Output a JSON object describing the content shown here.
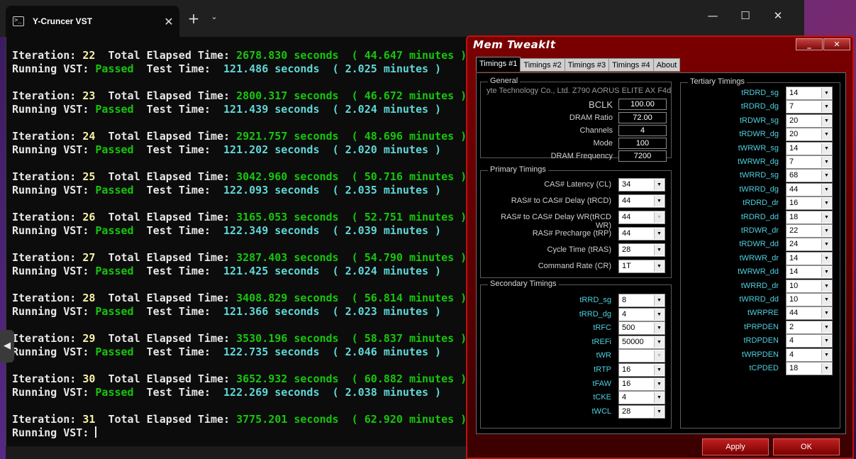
{
  "terminal": {
    "tab_title": "Y-Cruncer VST",
    "tab_icon": "terminal-icon",
    "new_tab_symbol": "+",
    "dropdown_symbol": "⌄",
    "close_symbol": "✕",
    "window_controls": {
      "minimize": "—",
      "maximize": "☐",
      "close": "✕"
    },
    "labels": {
      "iteration": "Iteration:",
      "total_elapsed": "Total Elapsed Time:",
      "seconds": "seconds",
      "minutes": "minutes",
      "running_vst": "Running VST:",
      "test_time": "Test Time:"
    },
    "iterations": [
      {
        "n": "22",
        "elapsed": "2678.830",
        "elapsed_min": "44.647",
        "status": "Passed",
        "test": "121.486",
        "test_min": "2.025"
      },
      {
        "n": "23",
        "elapsed": "2800.317",
        "elapsed_min": "46.672",
        "status": "Passed",
        "test": "121.439",
        "test_min": "2.024"
      },
      {
        "n": "24",
        "elapsed": "2921.757",
        "elapsed_min": "48.696",
        "status": "Passed",
        "test": "121.202",
        "test_min": "2.020"
      },
      {
        "n": "25",
        "elapsed": "3042.960",
        "elapsed_min": "50.716",
        "status": "Passed",
        "test": "122.093",
        "test_min": "2.035"
      },
      {
        "n": "26",
        "elapsed": "3165.053",
        "elapsed_min": "52.751",
        "status": "Passed",
        "test": "122.349",
        "test_min": "2.039"
      },
      {
        "n": "27",
        "elapsed": "3287.403",
        "elapsed_min": "54.790",
        "status": "Passed",
        "test": "121.425",
        "test_min": "2.024"
      },
      {
        "n": "28",
        "elapsed": "3408.829",
        "elapsed_min": "56.814",
        "status": "Passed",
        "test": "121.366",
        "test_min": "2.023"
      },
      {
        "n": "29",
        "elapsed": "3530.196",
        "elapsed_min": "58.837",
        "status": "Passed",
        "test": "122.735",
        "test_min": "2.046"
      },
      {
        "n": "30",
        "elapsed": "3652.932",
        "elapsed_min": "60.882",
        "status": "Passed",
        "test": "122.269",
        "test_min": "2.038"
      }
    ],
    "current": {
      "n": "31",
      "elapsed": "3775.201",
      "elapsed_min": "62.920"
    },
    "side_arrow": "◀"
  },
  "memtweak": {
    "title": "Mem TweakIt",
    "title_buttons": {
      "minimize": "_",
      "close": "✕"
    },
    "tabs": [
      "Timings #1",
      "Timings #2",
      "Timings #3",
      "Timings #4",
      "About"
    ],
    "general": {
      "title": "General",
      "board": "yte Technology Co., Ltd. Z790 AORUS ELITE AX F4d",
      "bclk_label": "BCLK",
      "bclk": "100.00",
      "ratio_label": "DRAM Ratio",
      "ratio": "72.00",
      "channels_label": "Channels",
      "channels": "4",
      "mode_label": "Mode",
      "mode": "100",
      "freq_label": "DRAM Frequency",
      "freq": "7200"
    },
    "primary": {
      "title": "Primary Timings",
      "items": [
        {
          "label": "CAS# Latency (CL)",
          "value": "34"
        },
        {
          "label": "RAS# to CAS# Delay (tRCD)",
          "value": "44"
        },
        {
          "label": "RAS# to CAS# Delay WR(tRCD WR)",
          "value": "44"
        },
        {
          "label": "RAS# Precharge (tRP)",
          "value": "44"
        },
        {
          "label": "Cycle Time (tRAS)",
          "value": "28"
        },
        {
          "label": "Command Rate (CR)",
          "value": "1T"
        }
      ]
    },
    "secondary": {
      "title": "Secondary Timings",
      "items": [
        {
          "label": "tRRD_sg",
          "value": "8"
        },
        {
          "label": "tRRD_dg",
          "value": "4"
        },
        {
          "label": "tRFC",
          "value": "500"
        },
        {
          "label": "tREFi",
          "value": "50000"
        },
        {
          "label": "tWR",
          "value": ""
        },
        {
          "label": "tRTP",
          "value": "16"
        },
        {
          "label": "tFAW",
          "value": "16"
        },
        {
          "label": "tCKE",
          "value": "4"
        },
        {
          "label": "tWCL",
          "value": "28"
        }
      ]
    },
    "tertiary": {
      "title": "Tertiary Timings",
      "items": [
        {
          "label": "tRDRD_sg",
          "value": "14"
        },
        {
          "label": "tRDRD_dg",
          "value": "7"
        },
        {
          "label": "tRDWR_sg",
          "value": "20"
        },
        {
          "label": "tRDWR_dg",
          "value": "20"
        },
        {
          "label": "tWRWR_sg",
          "value": "14"
        },
        {
          "label": "tWRWR_dg",
          "value": "7"
        },
        {
          "label": "tWRRD_sg",
          "value": "68"
        },
        {
          "label": "tWRRD_dg",
          "value": "44"
        },
        {
          "label": "tRDRD_dr",
          "value": "16"
        },
        {
          "label": "tRDRD_dd",
          "value": "18"
        },
        {
          "label": "tRDWR_dr",
          "value": "22"
        },
        {
          "label": "tRDWR_dd",
          "value": "24"
        },
        {
          "label": "tWRWR_dr",
          "value": "14"
        },
        {
          "label": "tWRWR_dd",
          "value": "14"
        },
        {
          "label": "tWRRD_dr",
          "value": "10"
        },
        {
          "label": "tWRRD_dd",
          "value": "10"
        },
        {
          "label": "tWRPRE",
          "value": "44"
        },
        {
          "label": "tPRPDEN",
          "value": "2"
        },
        {
          "label": "tRDPDEN",
          "value": "4"
        },
        {
          "label": "tWRPDEN",
          "value": "4"
        },
        {
          "label": "tCPDED",
          "value": "18"
        }
      ]
    },
    "buttons": {
      "apply": "Apply",
      "ok": "OK"
    }
  }
}
